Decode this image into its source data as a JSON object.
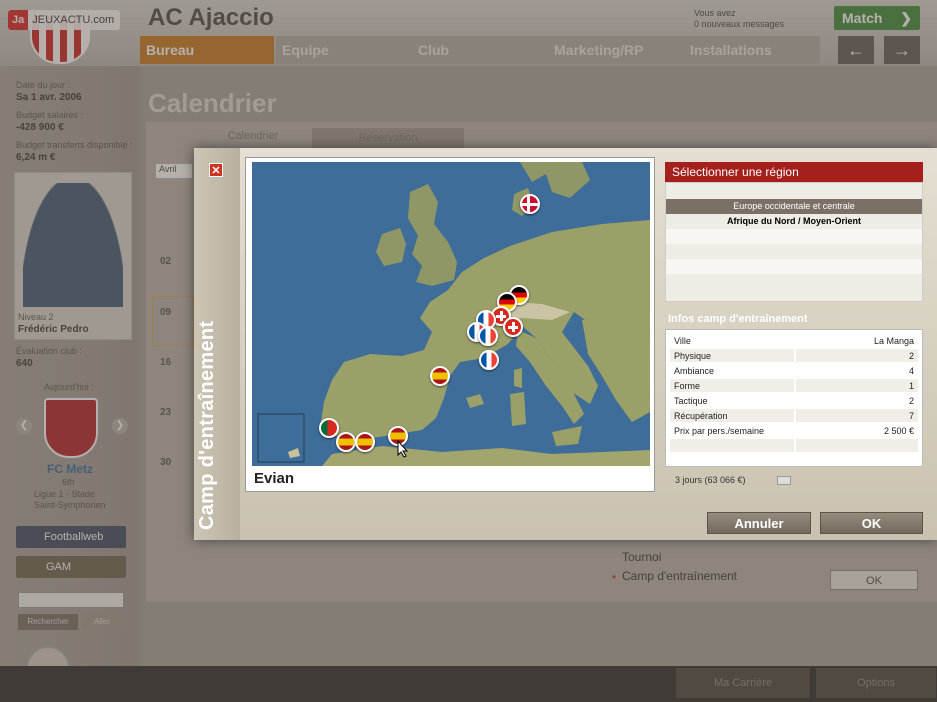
{
  "watermark": {
    "brand": "Ja",
    "site": "JEUXACTU.com"
  },
  "header": {
    "club_name": "AC Ajaccio",
    "messages_line1": "Vous avez",
    "messages_line2": "0 nouveaux messages",
    "match_label": "Match",
    "tabs": [
      {
        "label": "Bureau",
        "active": true
      },
      {
        "label": "Equipe",
        "active": false
      },
      {
        "label": "Club",
        "active": false
      },
      {
        "label": "Marketing/RP",
        "active": false
      },
      {
        "label": "Installations",
        "active": false
      }
    ]
  },
  "sidebar": {
    "date_label": "Date du jour :",
    "date_value": "Sa 1 avr. 2006",
    "budget_label": "Budget salaires :",
    "budget_value": "-428 900 €",
    "transfer_label": "Budget transferts disponible :",
    "transfer_value": "6,24 m €",
    "manager_label": "Niveau 2",
    "manager_name": "Frédéric Pedro",
    "eval_label": "Évaluation club :",
    "eval_value": "640",
    "next_match_label": "Aujourd'hui :",
    "opponent": "FC Metz",
    "opponent_rank": "6th",
    "opponent_info1": "Ligue 1 - Stade",
    "opponent_info2": "Saint-Symphorien",
    "footballweb_label": "Footballweb",
    "gam_label": "GAM",
    "search_label": "Rechercher",
    "ok_small": "Aller"
  },
  "main": {
    "title": "Calendrier",
    "subtabs": [
      "Calendrier",
      "Réservation"
    ],
    "month_label": "Avril",
    "week_rows": [
      "02",
      "09",
      "16",
      "23",
      "30"
    ],
    "options": [
      "Tournoi",
      "Camp d'entraînement"
    ],
    "ok_label": "OK"
  },
  "modal": {
    "side_title": "Camp d'entraînement",
    "map_location": "Evian",
    "region_header": "Sélectionner une région",
    "regions": [
      {
        "label": "Europe occidentale et centrale",
        "selected": true
      },
      {
        "label": "Afrique du Nord / Moyen-Orient",
        "selected": false
      }
    ],
    "info_title": "Infos camp d'entraînement",
    "info": [
      {
        "label": "Ville",
        "value": "La Manga"
      },
      {
        "label": "Physique",
        "value": "2"
      },
      {
        "label": "Ambiance",
        "value": "4"
      },
      {
        "label": "Forme",
        "value": "1"
      },
      {
        "label": "Tactique",
        "value": "2"
      },
      {
        "label": "Récupération",
        "value": "7"
      },
      {
        "label": "Prix par pers./semaine",
        "value": "2 500 €"
      }
    ],
    "duration": "3 jours (63 066 €)",
    "cancel_label": "Annuler",
    "ok_label": "OK"
  },
  "footer": {
    "career_label": "Ma Carrière",
    "options_label": "Options"
  }
}
